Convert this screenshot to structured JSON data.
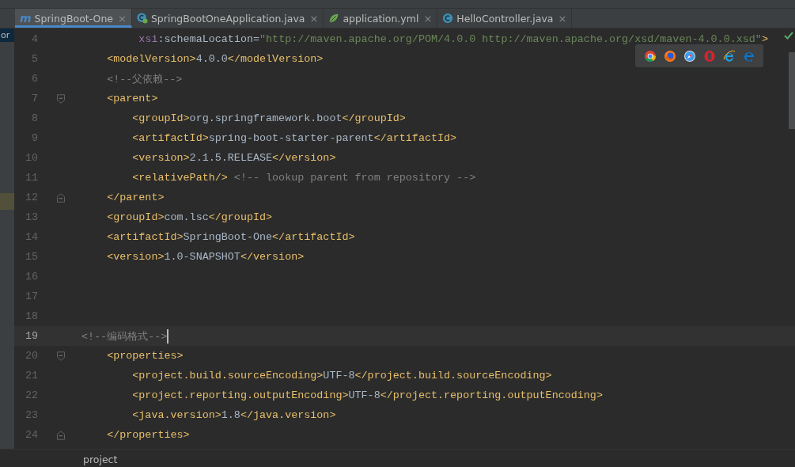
{
  "left_panel": {
    "label": "or"
  },
  "tabs": [
    {
      "label": "SpringBoot-One",
      "kind": "maven",
      "glyph": "m",
      "close": "×",
      "selected": true
    },
    {
      "label": "SpringBootOneApplication.java",
      "kind": "springclass",
      "close": "×",
      "selected": false
    },
    {
      "label": "application.yml",
      "kind": "config",
      "close": "×",
      "selected": false
    },
    {
      "label": "HelloController.java",
      "kind": "class",
      "close": "×",
      "selected": false
    }
  ],
  "lines": [
    {
      "number": "4",
      "kind": "continuation",
      "current": false,
      "tokens": [
        {
          "kind": "attr",
          "text": "xsi"
        },
        {
          "kind": "text",
          "text": ":schemaLocation="
        },
        {
          "kind": "string",
          "text": "\"http://maven.apache.org/POM/4.0.0 http://maven.apache.org/xsd/maven-4.0.0.xsd\""
        },
        {
          "kind": "tag",
          "text": ">"
        }
      ]
    },
    {
      "number": "5",
      "kind": "plain",
      "current": false,
      "tokens": [
        {
          "kind": "tag",
          "text": "    <modelVersion>"
        },
        {
          "kind": "text",
          "text": "4.0.0"
        },
        {
          "kind": "tag",
          "text": "</modelVersion>"
        }
      ]
    },
    {
      "number": "6",
      "kind": "plain",
      "current": false,
      "tokens": [
        {
          "kind": "comment",
          "text": "    <!--父依赖-->"
        }
      ]
    },
    {
      "number": "7",
      "kind": "foldstart",
      "current": false,
      "tokens": [
        {
          "kind": "tag",
          "text": "    <parent>"
        }
      ]
    },
    {
      "number": "8",
      "kind": "plain",
      "current": false,
      "tokens": [
        {
          "kind": "tag",
          "text": "        <groupId>"
        },
        {
          "kind": "text",
          "text": "org.springframework.boot"
        },
        {
          "kind": "tag",
          "text": "</groupId>"
        }
      ]
    },
    {
      "number": "9",
      "kind": "plain",
      "current": false,
      "tokens": [
        {
          "kind": "tag",
          "text": "        <artifactId>"
        },
        {
          "kind": "text",
          "text": "spring-boot-starter-parent"
        },
        {
          "kind": "tag",
          "text": "</artifactId>"
        }
      ]
    },
    {
      "number": "10",
      "kind": "plain",
      "current": false,
      "tokens": [
        {
          "kind": "tag",
          "text": "        <version>"
        },
        {
          "kind": "text",
          "text": "2.1.5.RELEASE"
        },
        {
          "kind": "tag",
          "text": "</version>"
        }
      ]
    },
    {
      "number": "11",
      "kind": "plain",
      "current": false,
      "tokens": [
        {
          "kind": "tag",
          "text": "        <relativePath/>"
        },
        {
          "kind": "comment",
          "text": " <!-- lookup parent from repository -->"
        }
      ]
    },
    {
      "number": "12",
      "kind": "foldend",
      "current": false,
      "tokens": [
        {
          "kind": "tag",
          "text": "    </parent>"
        }
      ]
    },
    {
      "number": "13",
      "kind": "plain",
      "current": false,
      "tokens": [
        {
          "kind": "tag",
          "text": "    <groupId>"
        },
        {
          "kind": "text",
          "text": "com.lsc"
        },
        {
          "kind": "tag",
          "text": "</groupId>"
        }
      ]
    },
    {
      "number": "14",
      "kind": "plain",
      "current": false,
      "tokens": [
        {
          "kind": "tag",
          "text": "    <artifactId>"
        },
        {
          "kind": "text",
          "text": "SpringBoot-One"
        },
        {
          "kind": "tag",
          "text": "</artifactId>"
        }
      ]
    },
    {
      "number": "15",
      "kind": "plain",
      "current": false,
      "tokens": [
        {
          "kind": "tag",
          "text": "    <version>"
        },
        {
          "kind": "text",
          "text": "1.0-SNAPSHOT"
        },
        {
          "kind": "tag",
          "text": "</version>"
        }
      ]
    },
    {
      "number": "16",
      "kind": "plain",
      "current": false
    },
    {
      "number": "17",
      "kind": "plain",
      "current": false
    },
    {
      "number": "18",
      "kind": "plain",
      "current": false
    },
    {
      "number": "19",
      "kind": "plain",
      "current": true,
      "tokens": [
        {
          "kind": "comment",
          "text": "<!--编码格式-->"
        }
      ]
    },
    {
      "number": "20",
      "kind": "foldstart",
      "current": false,
      "tokens": [
        {
          "kind": "tag",
          "text": "    <properties>"
        }
      ]
    },
    {
      "number": "21",
      "kind": "plain",
      "current": false,
      "tokens": [
        {
          "kind": "tag",
          "text": "        <project.build.sourceEncoding>"
        },
        {
          "kind": "text",
          "text": "UTF-8"
        },
        {
          "kind": "tag",
          "text": "</project.build.sourceEncoding>"
        }
      ]
    },
    {
      "number": "22",
      "kind": "plain",
      "current": false,
      "tokens": [
        {
          "kind": "tag",
          "text": "        <project.reporting.outputEncoding>"
        },
        {
          "kind": "text",
          "text": "UTF-8"
        },
        {
          "kind": "tag",
          "text": "</project.reporting.outputEncoding>"
        }
      ]
    },
    {
      "number": "23",
      "kind": "plain",
      "current": false,
      "tokens": [
        {
          "kind": "tag",
          "text": "        <java.version>"
        },
        {
          "kind": "text",
          "text": "1.8"
        },
        {
          "kind": "tag",
          "text": "</java.version>"
        }
      ]
    },
    {
      "number": "24",
      "kind": "foldend",
      "current": false,
      "tokens": [
        {
          "kind": "tag",
          "text": "    </properties>"
        }
      ]
    }
  ],
  "browser_icons": [
    {
      "kind": "chrome"
    },
    {
      "kind": "firefox"
    },
    {
      "kind": "safari"
    },
    {
      "kind": "opera"
    },
    {
      "kind": "ie"
    },
    {
      "kind": "edge"
    }
  ],
  "breadcrumb": "project"
}
